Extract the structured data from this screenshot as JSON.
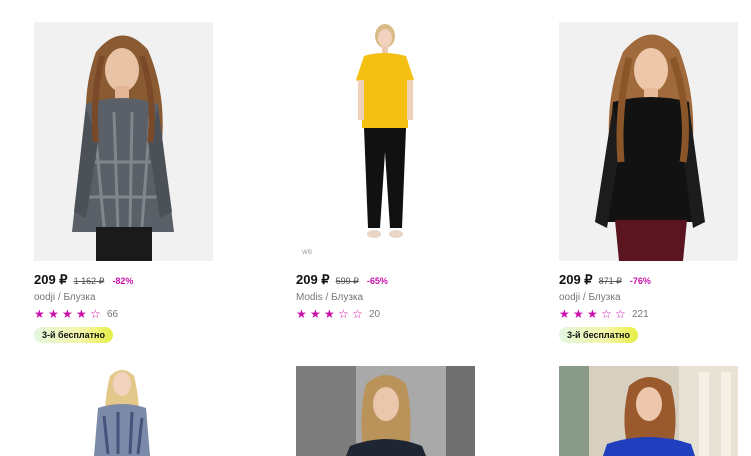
{
  "products": [
    {
      "price": "209 ₽",
      "old_price": "1 162 ₽",
      "discount": "-82%",
      "brand": "oodji",
      "category": "Блузка",
      "rating": 4,
      "reviews": "66",
      "promo": "3-й бесплатно",
      "image": "woman-paisley-blouse"
    },
    {
      "price": "209 ₽",
      "old_price": "599 ₽",
      "discount": "-65%",
      "brand": "Modis",
      "category": "Блузка",
      "rating": 3,
      "reviews": "20",
      "promo": "",
      "image": "woman-yellow-top",
      "watermark": "WB"
    },
    {
      "price": "209 ₽",
      "old_price": "871 ₽",
      "discount": "-76%",
      "brand": "oodji",
      "category": "Блузка",
      "rating": 3,
      "reviews": "221",
      "promo": "3-й бесплатно",
      "image": "woman-black-blouse"
    }
  ],
  "second_row": [
    {
      "image": "woman-blue-print-blouse"
    },
    {
      "image": "woman-navy-top-grey-backdrop"
    },
    {
      "image": "woman-blue-top-interior"
    }
  ],
  "separator": " / ",
  "colors": {
    "accent": "#cb11ab",
    "star": "#cb11ab"
  }
}
